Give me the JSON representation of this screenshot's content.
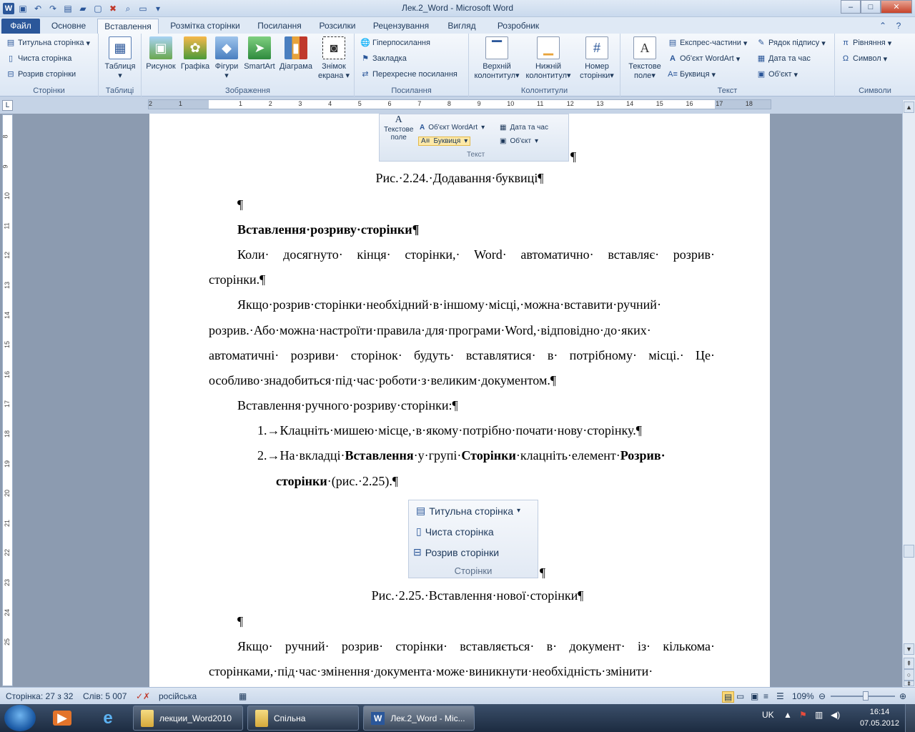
{
  "window": {
    "title": "Лек.2_Word - Microsoft Word",
    "controls": {
      "minimize": "–",
      "maximize": "□",
      "close": "✕"
    }
  },
  "ribbon_tabs": [
    "Файл",
    "Основне",
    "Вставлення",
    "Розмітка сторінки",
    "Посилання",
    "Розсилки",
    "Рецензування",
    "Вигляд",
    "Розробник"
  ],
  "ribbon": {
    "pages_group": {
      "label": "Сторінки",
      "items": [
        "Титульна сторінка",
        "Чиста сторінка",
        "Розрив сторінки"
      ]
    },
    "tables_group": {
      "label": "Таблиці",
      "button": "Таблиця"
    },
    "images_group": {
      "label": "Зображення",
      "buttons": [
        "Рисунок",
        "Графіка",
        "Фігури",
        "SmartArt",
        "Діаграма",
        "Знімок",
        "екрана"
      ]
    },
    "links_group": {
      "label": "Посилання",
      "items": [
        "Гіперпосилання",
        "Закладка",
        "Перехресне посилання"
      ]
    },
    "headers_group": {
      "label": "Колонтитули",
      "buttons": [
        "Верхній",
        "колонтитул",
        "Нижній",
        "колонтитул",
        "Номер",
        "сторінки"
      ]
    },
    "text_group": {
      "label": "Текст",
      "textbox": [
        "Текстове",
        "поле"
      ],
      "items": [
        "Експрес-частини",
        "Об'єкт WordArt",
        "Буквиця",
        "Рядок підпису",
        "Дата та час",
        "Об'єкт"
      ]
    },
    "symbols_group": {
      "label": "Символи",
      "items": [
        "Рівняння",
        "Символ"
      ]
    }
  },
  "ruler": {
    "h_numbers": [
      "2",
      "1",
      "1",
      "2",
      "3",
      "4",
      "5",
      "6",
      "7",
      "8",
      "9",
      "10",
      "11",
      "12",
      "13",
      "14",
      "15",
      "16",
      "17",
      "18"
    ],
    "v_numbers": [
      "8",
      "9",
      "10",
      "11",
      "12",
      "13",
      "14",
      "15",
      "16",
      "17",
      "18",
      "19",
      "20",
      "21",
      "22",
      "23",
      "24",
      "25"
    ]
  },
  "document": {
    "embedded_image_1": {
      "items": [
        "Текстове",
        "поле",
        "Об'єкт WordArt",
        "Дата та час",
        "Буквиця",
        "Об'єкт",
        "Текст"
      ],
      "pilcrow": "¶"
    },
    "caption_1": "Рис.·2.24.·Додавання·буквиці¶",
    "empty_1": "¶",
    "heading": "Вставлення·розриву·сторінки¶",
    "p1_line1": "Коли·  досягнуто·  кінця·  сторінки,·  Word·  автоматично·  вставляє·  розрив·",
    "p1_line2": "сторінки.¶",
    "p2_line1": "Якщо·розрив·сторінки·необхідний·в·іншому·місці,·можна·вставити·ручний·",
    "p2_line2": "розрив.·Або·можна·настроїти·правила·для·програми·Word,·відповідно·до·яких·",
    "p2_line3": "автоматичні·  розриви·  сторінок·  будуть·  вставлятися·  в·  потрібному·  місці.·  Це·",
    "p2_line4": "особливо·знадобиться·під·час·роботи·з·великим·документом.¶",
    "p3": "Вставлення·ручного·розриву·сторінки:¶",
    "list1_num": "1.→",
    "list1_text": "Клацніть·мишею·місце,·в·якому·потрібно·почати·нову·сторінку.¶",
    "list2_num": "2.→",
    "list2_a": "На·вкладці·",
    "list2_b": "Вставлення",
    "list2_c": "·у·групі·",
    "list2_d": "Сторінки",
    "list2_e": "·клацніть·елемент·",
    "list2_f": "Розрив·",
    "list2_g": "сторінки",
    "list2_h": "·(рис.·2.25).¶",
    "embedded_image_2": {
      "items": [
        "Титульна сторінка",
        "Чиста сторінка",
        "Розрив сторінки"
      ],
      "label": "Сторінки",
      "pilcrow": "¶"
    },
    "caption_2": "Рис.·2.25.·Вставлення·нової·сторінки¶",
    "empty_2": "¶",
    "p4_line1": "Якщо·  ручний·  розрив·  сторінки·  вставляється·  в·  документ·  із·  кількома·",
    "p4_line2": "сторінками,·під·час·змінення·документа·може·виникнути·необхідність·змінити·"
  },
  "statusbar": {
    "page": "Сторінка: 27 з 32",
    "words": "Слів: 5 007",
    "language": "російська",
    "zoom": "109%"
  },
  "taskbar": {
    "tasks": [
      "лекции_Word2010",
      "Спільна",
      "Лек.2_Word - Mic..."
    ],
    "language": "UK",
    "time": "16:14",
    "date": "07.05.2012"
  }
}
